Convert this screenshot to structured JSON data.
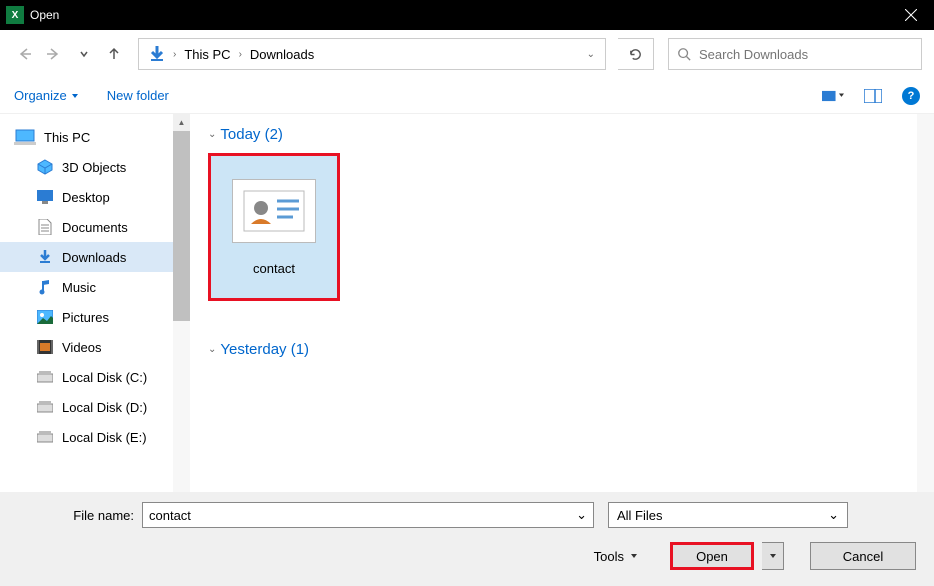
{
  "window": {
    "title": "Open"
  },
  "breadcrumb": {
    "root": "This PC",
    "folder": "Downloads"
  },
  "search": {
    "placeholder": "Search Downloads"
  },
  "toolbar": {
    "organize": "Organize",
    "newfolder": "New folder"
  },
  "sidebar": {
    "root": "This PC",
    "items": [
      {
        "label": "3D Objects"
      },
      {
        "label": "Desktop"
      },
      {
        "label": "Documents"
      },
      {
        "label": "Downloads"
      },
      {
        "label": "Music"
      },
      {
        "label": "Pictures"
      },
      {
        "label": "Videos"
      },
      {
        "label": "Local Disk (C:)"
      },
      {
        "label": "Local Disk (D:)"
      },
      {
        "label": "Local Disk (E:)"
      }
    ]
  },
  "groups": {
    "today": {
      "label": "Today (2)"
    },
    "yesterday": {
      "label": "Yesterday (1)"
    }
  },
  "files": {
    "contact": "contact"
  },
  "footer": {
    "filename_label": "File name:",
    "filename_value": "contact",
    "filter": "All Files",
    "tools": "Tools",
    "open": "Open",
    "cancel": "Cancel"
  }
}
